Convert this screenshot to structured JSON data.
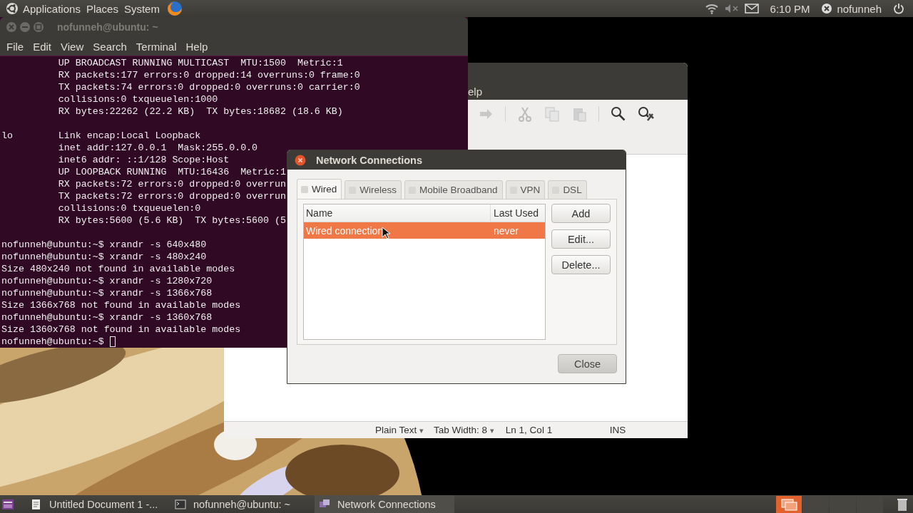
{
  "top_panel": {
    "menus": [
      "Applications",
      "Places",
      "System"
    ],
    "clock": "6:10 PM",
    "user": "nofunneh"
  },
  "terminal": {
    "title": "nofunneh@ubuntu: ~",
    "menu": [
      "File",
      "Edit",
      "View",
      "Search",
      "Terminal",
      "Help"
    ],
    "blocks": [
      [
        "          UP BROADCAST RUNNING MULTICAST  MTU:1500  Metric:1",
        "          RX packets:177 errors:0 dropped:14 overruns:0 frame:0",
        "          TX packets:74 errors:0 dropped:0 overruns:0 carrier:0",
        "          collisions:0 txqueuelen:1000",
        "          RX bytes:22262 (22.2 KB)  TX bytes:18682 (18.6 KB)"
      ],
      [
        "lo        Link encap:Local Loopback",
        "          inet addr:127.0.0.1  Mask:255.0.0.0",
        "          inet6 addr: ::1/128 Scope:Host",
        "          UP LOOPBACK RUNNING  MTU:16436  Metric:1",
        "          RX packets:72 errors:0 dropped:0 overrun",
        "          TX packets:72 errors:0 dropped:0 overrun",
        "          collisions:0 txqueuelen:0",
        "          RX bytes:5600 (5.6 KB)  TX bytes:5600 (5"
      ],
      [
        "nofunneh@ubuntu:~$ xrandr -s 640x480",
        "nofunneh@ubuntu:~$ xrandr -s 480x240",
        "Size 480x240 not found in available modes",
        "nofunneh@ubuntu:~$ xrandr -s 1280x720",
        "nofunneh@ubuntu:~$ xrandr -s 1366x768",
        "Size 1366x768 not found in available modes",
        "nofunneh@ubuntu:~$ xrandr -s 1360x768",
        "Size 1360x768 not found in available modes"
      ]
    ],
    "prompt": "nofunneh@ubuntu:~$"
  },
  "editor": {
    "menu_fragment": "elp",
    "status": {
      "language": {
        "label": "Plain Text",
        "caret": "▾"
      },
      "tab_width": {
        "label": "Tab Width: 8",
        "caret": "▾"
      },
      "position": "Ln 1, Col 1",
      "mode": "INS"
    }
  },
  "dialog": {
    "title": "Network Connections",
    "tabs": [
      {
        "label": "Wired",
        "selected": true
      },
      {
        "label": "Wireless",
        "selected": false
      },
      {
        "label": "Mobile Broadband",
        "selected": false
      },
      {
        "label": "VPN",
        "selected": false
      },
      {
        "label": "DSL",
        "selected": false
      }
    ],
    "columns": [
      "Name",
      "Last Used"
    ],
    "rows": [
      {
        "name": "Wired connection",
        "last_used": "never",
        "selected": true
      }
    ],
    "buttons": [
      "Add",
      "Edit...",
      "Delete..."
    ],
    "close": "Close"
  },
  "taskbar": {
    "items": [
      {
        "label": "Untitled Document 1 -...",
        "kind": "editor",
        "selected": false
      },
      {
        "label": "nofunneh@ubuntu: ~",
        "kind": "terminal",
        "selected": false
      },
      {
        "label": "Network Connections",
        "kind": "network",
        "selected": true
      }
    ]
  }
}
